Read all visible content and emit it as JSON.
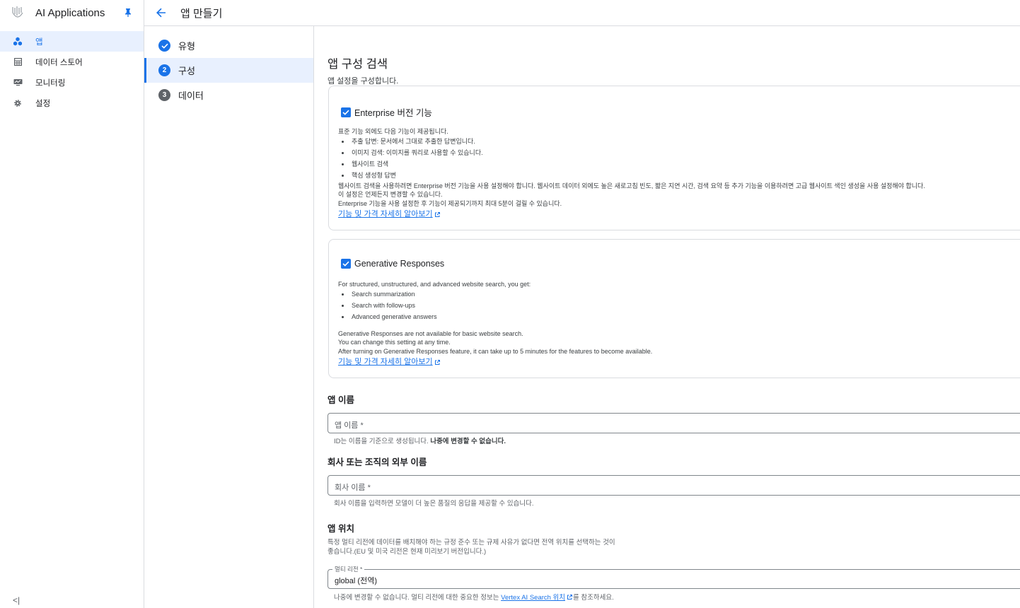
{
  "app": {
    "title": "AI Applications"
  },
  "sidebar": {
    "items": [
      {
        "label": "앱",
        "icon": "apps-icon",
        "active": true
      },
      {
        "label": "데이터 스토어",
        "icon": "table-icon",
        "active": false
      },
      {
        "label": "모니터링",
        "icon": "monitoring-icon",
        "active": false
      },
      {
        "label": "설정",
        "icon": "gear-icon",
        "active": false
      }
    ],
    "collapse_glyph": "<|"
  },
  "topbar": {
    "title": "앱 만들기"
  },
  "stepper": {
    "steps": [
      {
        "num": "✓",
        "label": "유형",
        "state": "done"
      },
      {
        "num": "2",
        "label": "구성",
        "state": "active"
      },
      {
        "num": "3",
        "label": "데이터",
        "state": "todo"
      }
    ]
  },
  "main": {
    "title": "앱 구성 검색",
    "subtitle": "앱 설정을 구성합니다.",
    "enterprise": {
      "label": "Enterprise 버전 기능",
      "checked": true,
      "intro": "표준 기능 외에도 다음 기능이 제공됩니다.",
      "bullets": [
        "추출 답변: 문서에서 그대로 추출한 답변입니다.",
        "이미지 검색: 이미지를 쿼리로 사용할 수 있습니다.",
        "웹사이트 검색",
        "핵심 생성형 답변"
      ],
      "notes": [
        "웹사이트 검색을 사용하려면 Enterprise 버전 기능을 사용 설정해야 합니다. 웹사이트 데이터 외에도 높은 새로고침 빈도, 짧은 지연 시간, 검색 요약 등 추가 기능을 이용하려면 고급 웹사이트 색인 생성을 사용 설정해야 합니다.",
        "이 설정은 언제든지 변경할 수 있습니다.",
        "Enterprise 기능을 사용 설정한 후 기능이 제공되기까지 최대 5분이 걸릴 수 있습니다."
      ],
      "link": "기능 및 가격 자세히 알아보기"
    },
    "generative": {
      "label": "Generative Responses",
      "checked": true,
      "intro": "For structured, unstructured, and advanced website search, you get:",
      "bullets": [
        "Search summarization",
        "Search with follow-ups",
        "Advanced generative answers"
      ],
      "notes": [
        "Generative Responses are not available for basic website search.",
        "You can change this setting at any time.",
        "After turning on Generative Responses feature, it can take up to 5 minutes for the features to become available."
      ],
      "link": "기능 및 가격 자세히 알아보기"
    },
    "app_name": {
      "heading": "앱 이름",
      "placeholder": "앱 이름 *",
      "hint_plain": "ID는 이름을 기준으로 생성됩니다. ",
      "hint_bold": "나중에 변경할 수 없습니다."
    },
    "company": {
      "heading": "회사 또는 조직의 외부 이름",
      "placeholder": "회사 이름 *",
      "hint": "회사 이름을 입력하면 모델이 더 높은 품질의 응답을 제공할 수 있습니다."
    },
    "location": {
      "heading": "앱 위치",
      "desc1": "특정 멀티 리전에 데이터를 배치해야 하는 규정 준수 또는 규제 사유가 없다면 전역 위치를 선택하는 것이",
      "desc2": "좋습니다.(EU 및 미국 리전은 현재 미리보기 버전입니다.)",
      "field_label": "멀티 리전 *",
      "field_value": "global (전역)",
      "footer_before": "나중에 변경할 수 없습니다. 멀티 리전에 대한 중요한 정보는 ",
      "footer_link": "Vertex AI Search 위치",
      "footer_after": "를 참조하세요."
    }
  },
  "colors": {
    "accent": "#1a73e8",
    "active_bg": "#e8f0fe",
    "step_todo": "#5f6368",
    "border": "#dadce0"
  }
}
